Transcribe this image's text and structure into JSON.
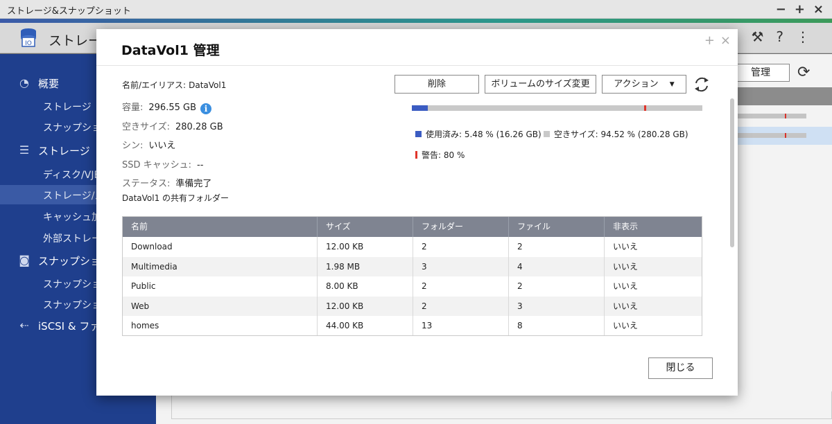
{
  "window": {
    "title": "ストレージ&スナップショット"
  },
  "app": {
    "name": "ストレージ"
  },
  "sidebar": {
    "overview": "概要",
    "overview_items": [
      "ストレージ",
      "スナップショ"
    ],
    "storage": "ストレージ",
    "storage_items": [
      "ディスク/VJB",
      "ストレージ/ス",
      "キャッシュ加",
      "外部ストレー"
    ],
    "snapshot": "スナップショ",
    "snapshot_items": [
      "スナップショ",
      "スナップショ"
    ],
    "iscsi": "iSCSI & ファ"
  },
  "background": {
    "manage_label": "管理"
  },
  "modal": {
    "title": "DataVol1 管理",
    "name_label": "名前/エイリアス:",
    "name_value": "DataVol1",
    "capacity_label": "容量:",
    "capacity_value": "296.55 GB",
    "free_label": "空きサイズ:",
    "free_value": "280.28 GB",
    "thin_label": "シン:",
    "thin_value": "いいえ",
    "ssd_label": "SSD キャッシュ:",
    "ssd_value": "--",
    "status_label": "ステータス:",
    "status_value": "準備完了",
    "shared_title": "DataVol1 の共有フォルダー",
    "buttons": {
      "delete": "削除",
      "resize": "ボリュームのサイズ変更",
      "action": "アクション"
    },
    "usage": {
      "used_fraction": 0.0548,
      "warning_fraction": 0.8,
      "used_label": "使用済み: 5.48 % (16.26 GB)",
      "free_label": "空きサイズ: 94.52 % (280.28 GB)",
      "warning_label": "警告: 80 %",
      "used_color": "#3b5cc2",
      "free_color": "#c9c9c9",
      "warning_color": "#e0352b"
    },
    "table": {
      "headers": [
        "名前",
        "サイズ",
        "フォルダー",
        "ファイル",
        "非表示"
      ],
      "rows": [
        [
          "Download",
          "12.00 KB",
          "2",
          "2",
          "いいえ"
        ],
        [
          "Multimedia",
          "1.98 MB",
          "3",
          "4",
          "いいえ"
        ],
        [
          "Public",
          "8.00 KB",
          "2",
          "2",
          "いいえ"
        ],
        [
          "Web",
          "12.00 KB",
          "2",
          "3",
          "いいえ"
        ],
        [
          "homes",
          "44.00 KB",
          "13",
          "8",
          "いいえ"
        ]
      ]
    },
    "close_label": "閉じる"
  }
}
